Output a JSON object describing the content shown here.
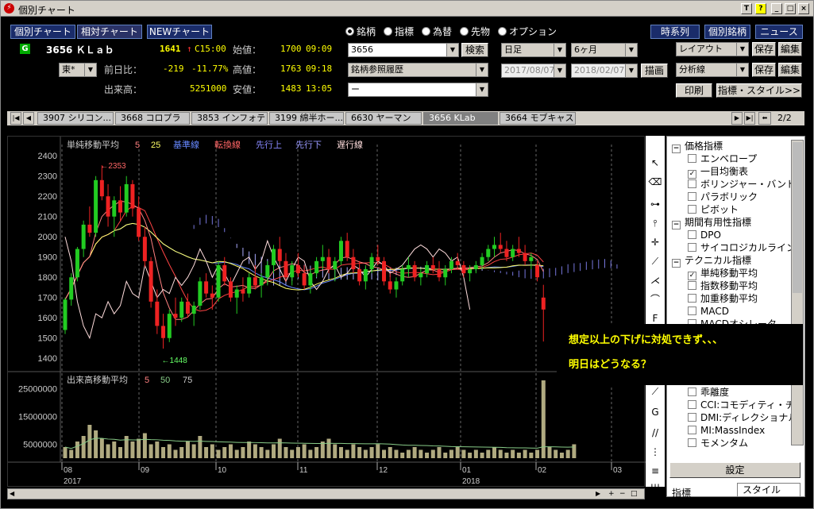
{
  "window": {
    "title": "個別チャート"
  },
  "title_buttons": [
    "T",
    "?",
    "_",
    "□",
    "×"
  ],
  "nav_buttons": {
    "individual": "個別チャート",
    "relative": "相対チャート",
    "new": "NEWチャート"
  },
  "radios": [
    {
      "label": "銘柄",
      "selected": true
    },
    {
      "label": "指標",
      "selected": false
    },
    {
      "label": "為替",
      "selected": false
    },
    {
      "label": "先物",
      "selected": false
    },
    {
      "label": "オプション",
      "selected": false
    }
  ],
  "right_buttons": {
    "timeseries": "時系列",
    "individual_stock": "個別銘柄",
    "news": "ニュース"
  },
  "quote": {
    "badge": "G",
    "code_name": "3656 ＫＬａｂ",
    "price": "1641",
    "arrow": "↑",
    "time_flag": "C15:00",
    "exchange": "東*",
    "open_label": "始値：",
    "open_value": "1700",
    "open_time": "09:09",
    "high_label": "高値：",
    "high_value": "1763",
    "high_time": "09:18",
    "low_label": "安値：",
    "low_value": "1483",
    "low_time": "13:05",
    "change_label": "前日比：",
    "change_value": "-219",
    "change_pct": "-11.77%",
    "volume_label": "出来高：",
    "volume_value": "5251000"
  },
  "search": {
    "code": "3656",
    "search_button": "検索",
    "history": "銘柄参照履歴",
    "third": "ー"
  },
  "period": {
    "interval": "日足",
    "range": "6ヶ月",
    "from": "2017/08/07",
    "to": "2018/02/07",
    "draw_button": "描画"
  },
  "layout": {
    "layout_label": "レイアウト",
    "save": "保存",
    "edit": "編集",
    "analysis_label": "分析線",
    "print": "印刷",
    "indicator_style": "指標・スタイル>>"
  },
  "stock_tabs": [
    "3907 シリコン...",
    "3668 コロプラ",
    "3853 インフォテリ",
    "3199 綿半ホー...",
    "6630 ヤーマン",
    "3656 KLab",
    "3664 モブキャス"
  ],
  "tab_page": "2/2",
  "legend": {
    "title": "単純移動平均",
    "p1": "5",
    "p2": "25",
    "kijun": "基準線",
    "tenkan": "転換線",
    "senkou_up": "先行上",
    "senkou_down": "先行下",
    "chikou": "遅行線"
  },
  "vol_legend": {
    "title": "出来高移動平均",
    "p1": "5",
    "p2": "50",
    "p3": "75"
  },
  "annotations": {
    "high": "←2353",
    "low": "←1448"
  },
  "overlay": {
    "line1": "想定以上の下げに対処できず、、、",
    "line2": "明日はどうなる？"
  },
  "indicator_tree": [
    {
      "label": "価格指標",
      "type": "cat",
      "mark": "−"
    },
    {
      "label": "エンベロープ",
      "type": "item",
      "checked": false
    },
    {
      "label": "一目均衡表",
      "type": "item",
      "checked": true
    },
    {
      "label": "ボリンジャー・バンド",
      "type": "item",
      "checked": false
    },
    {
      "label": "パラボリック",
      "type": "item",
      "checked": false
    },
    {
      "label": "ピボット",
      "type": "item",
      "checked": false
    },
    {
      "label": "期間有用性指標",
      "type": "cat",
      "mark": "−"
    },
    {
      "label": "DPO",
      "type": "item",
      "checked": false
    },
    {
      "label": "サイコロジカルライン",
      "type": "item",
      "checked": false
    },
    {
      "label": "テクニカル指標",
      "type": "cat",
      "mark": "−"
    },
    {
      "label": "単純移動平均",
      "type": "item",
      "checked": true
    },
    {
      "label": "指数移動平均",
      "type": "item",
      "checked": false
    },
    {
      "label": "加重移動平均",
      "type": "item",
      "checked": false
    },
    {
      "label": "MACD",
      "type": "item",
      "checked": false
    },
    {
      "label": "MACDオシレータ",
      "type": "item",
      "checked": false
    }
  ],
  "indicator_tree_lower": [
    {
      "label": "乖離度",
      "checked": false
    },
    {
      "label": "CCI:コモディティ・チャ",
      "checked": false
    },
    {
      "label": "DMI:ディレクショナル",
      "checked": false
    },
    {
      "label": "MI:MassIndex",
      "checked": false
    },
    {
      "label": "モメンタム",
      "checked": false
    }
  ],
  "panel_buttons": {
    "settings": "設定",
    "tab_indicator": "指標",
    "tab_style": "スタイル"
  },
  "chart_data": {
    "type": "candlestick",
    "y_ticks": [
      1400,
      1500,
      1600,
      1700,
      1800,
      1900,
      2000,
      2100,
      2200,
      2300,
      2400
    ],
    "ylim": [
      1350,
      2440
    ],
    "vol_ticks": [
      5000000,
      15000000,
      25000000
    ],
    "vol_tick_labels": [
      "5000000",
      "15000000",
      "25000000"
    ],
    "x_months": [
      "08",
      "09",
      "10",
      "11",
      "12",
      "01",
      "02",
      "03"
    ],
    "x_years": [
      {
        "label": "2017",
        "month_index": 0
      },
      {
        "label": "2018",
        "month_index": 5
      }
    ],
    "colors": {
      "up": "#22cc22",
      "down": "#ee2222",
      "ma5": "#ff8080",
      "ma25": "#ffff66",
      "kijun": "#6688ff",
      "tenkan": "#ff4444",
      "span_a": "#8888ff",
      "span_b": "#9999ff",
      "chikou": "#ffdddd"
    },
    "candles_approx": [
      [
        1540,
        1700,
        1520,
        1690
      ],
      [
        1690,
        1820,
        1660,
        1800
      ],
      [
        1800,
        1950,
        1780,
        1940
      ],
      [
        1940,
        2080,
        1900,
        2060
      ],
      [
        2060,
        2150,
        2000,
        2020
      ],
      [
        2020,
        2300,
        2000,
        2280
      ],
      [
        2280,
        2353,
        2180,
        2200
      ],
      [
        2200,
        2260,
        2050,
        2100
      ],
      [
        2100,
        2200,
        2000,
        2180
      ],
      [
        2180,
        2250,
        2080,
        2120
      ],
      [
        2120,
        2300,
        2100,
        2260
      ],
      [
        2260,
        2280,
        2100,
        2140
      ],
      [
        2140,
        2200,
        1980,
        2000
      ],
      [
        2000,
        2050,
        1850,
        1880
      ],
      [
        1880,
        1900,
        1650,
        1680
      ],
      [
        1680,
        1740,
        1520,
        1560
      ],
      [
        1560,
        1620,
        1448,
        1500
      ],
      [
        1500,
        1640,
        1480,
        1620
      ],
      [
        1620,
        1700,
        1560,
        1600
      ],
      [
        1600,
        1700,
        1580,
        1680
      ],
      [
        1680,
        1720,
        1600,
        1620
      ],
      [
        1620,
        1680,
        1560,
        1660
      ],
      [
        1660,
        1800,
        1640,
        1780
      ],
      [
        1780,
        1820,
        1700,
        1720
      ],
      [
        1720,
        1760,
        1640,
        1700
      ],
      [
        1700,
        1880,
        1680,
        1860
      ],
      [
        1860,
        1900,
        1760,
        1780
      ],
      [
        1780,
        1800,
        1680,
        1700
      ],
      [
        1700,
        1760,
        1620,
        1740
      ],
      [
        1740,
        1800,
        1680,
        1720
      ],
      [
        1720,
        1820,
        1700,
        1800
      ],
      [
        1800,
        1860,
        1740,
        1760
      ],
      [
        1760,
        1820,
        1700,
        1800
      ],
      [
        1800,
        1880,
        1760,
        1860
      ],
      [
        1860,
        1960,
        1820,
        1940
      ],
      [
        1940,
        2000,
        1860,
        1880
      ],
      [
        1880,
        1920,
        1780,
        1800
      ],
      [
        1800,
        1880,
        1760,
        1860
      ],
      [
        1860,
        1920,
        1800,
        1820
      ],
      [
        1820,
        1860,
        1740,
        1760
      ],
      [
        1760,
        1840,
        1720,
        1820
      ],
      [
        1820,
        1900,
        1800,
        1880
      ],
      [
        1880,
        1960,
        1840,
        1900
      ],
      [
        1900,
        1940,
        1820,
        1840
      ],
      [
        1840,
        1900,
        1780,
        1880
      ],
      [
        1880,
        2000,
        1860,
        1980
      ],
      [
        1980,
        2020,
        1880,
        1900
      ],
      [
        1900,
        1940,
        1820,
        1840
      ],
      [
        1840,
        1880,
        1760,
        1780
      ],
      [
        1780,
        1860,
        1740,
        1840
      ],
      [
        1840,
        1920,
        1820,
        1900
      ],
      [
        1900,
        1960,
        1860,
        1880
      ],
      [
        1880,
        1900,
        1760,
        1780
      ],
      [
        1780,
        1820,
        1720,
        1740
      ],
      [
        1740,
        1800,
        1700,
        1780
      ],
      [
        1780,
        1860,
        1760,
        1840
      ],
      [
        1840,
        1900,
        1800,
        1860
      ],
      [
        1860,
        1880,
        1780,
        1800
      ],
      [
        1800,
        1840,
        1760,
        1820
      ],
      [
        1820,
        1880,
        1800,
        1860
      ],
      [
        1860,
        1900,
        1820,
        1840
      ],
      [
        1840,
        1880,
        1780,
        1800
      ],
      [
        1800,
        1860,
        1760,
        1840
      ],
      [
        1840,
        1900,
        1820,
        1880
      ],
      [
        1880,
        1920,
        1840,
        1860
      ],
      [
        1860,
        1880,
        1800,
        1820
      ],
      [
        1820,
        1860,
        1780,
        1840
      ],
      [
        1840,
        1880,
        1820,
        1860
      ],
      [
        1860,
        1920,
        1840,
        1900
      ],
      [
        1900,
        1960,
        1880,
        1940
      ],
      [
        1940,
        2000,
        1900,
        1960
      ],
      [
        1960,
        2020,
        1920,
        1940
      ],
      [
        1940,
        1980,
        1880,
        1900
      ],
      [
        1900,
        1960,
        1880,
        1940
      ],
      [
        1940,
        2000,
        1900,
        1920
      ],
      [
        1920,
        1960,
        1860,
        1880
      ],
      [
        1880,
        1920,
        1840,
        1900
      ],
      [
        1860,
        1880,
        1780,
        1800
      ],
      [
        1700,
        1763,
        1483,
        1641
      ]
    ],
    "volume_approx": [
      4,
      3,
      6,
      8,
      12,
      10,
      7,
      5,
      6,
      4,
      8,
      6,
      7,
      9,
      5,
      6,
      4,
      5,
      3,
      4,
      6,
      5,
      8,
      4,
      5,
      3,
      4,
      5,
      3,
      4,
      6,
      5,
      4,
      3,
      5,
      7,
      4,
      3,
      4,
      5,
      3,
      4,
      6,
      7,
      5,
      4,
      3,
      5,
      4,
      3,
      4,
      5,
      3,
      4,
      3,
      2,
      3,
      4,
      3,
      2,
      3,
      4,
      2,
      3,
      4,
      3,
      2,
      3,
      2,
      3,
      4,
      3,
      2,
      3,
      2,
      3,
      2,
      3,
      28,
      4,
      3,
      2,
      3,
      5
    ]
  }
}
